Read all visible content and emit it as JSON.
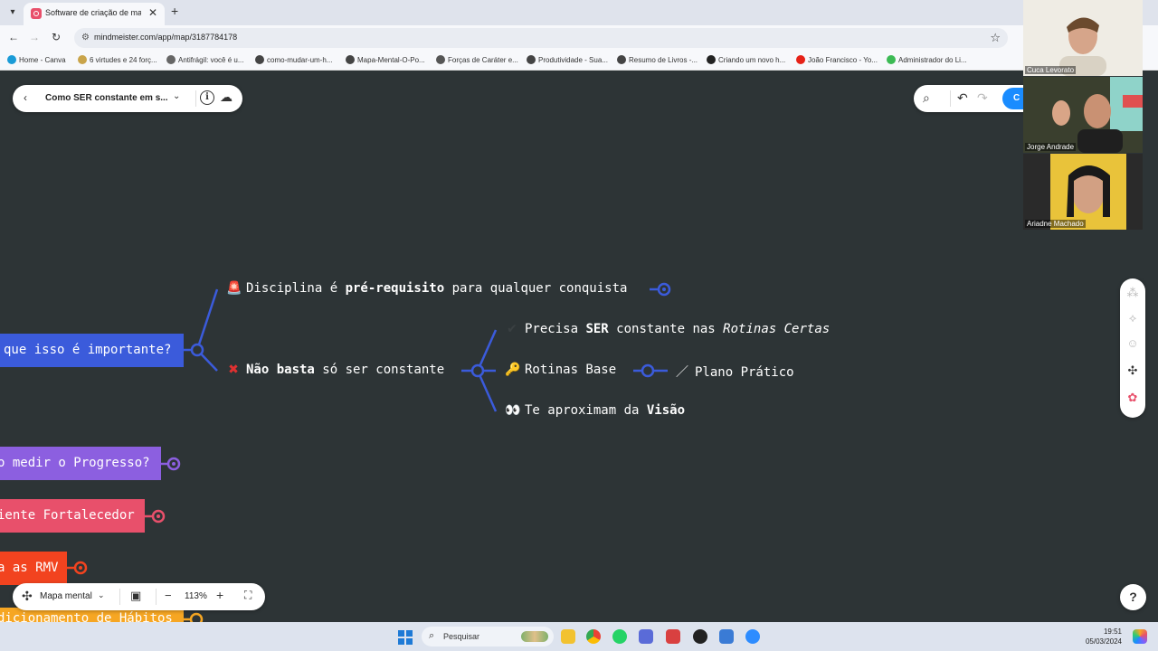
{
  "browser": {
    "tab_title": "Software de criação de mapas",
    "tab_close": "✕",
    "new_tab": "+",
    "url": "mindmeister.com/app/map/3187784178",
    "bookmarks": [
      {
        "label": "Home - Canva",
        "color": "#1a9bd7"
      },
      {
        "label": "6 virtudes e 24 forç...",
        "color": "#c9a44a"
      },
      {
        "label": "Antifrágil: você é u...",
        "color": "#666666"
      },
      {
        "label": "como-mudar-um-h...",
        "color": "#444444"
      },
      {
        "label": "Mapa-Mental-O-Po...",
        "color": "#444444"
      },
      {
        "label": "Forças de Caráter e...",
        "color": "#555555"
      },
      {
        "label": "Produtividade - Sua...",
        "color": "#444444"
      },
      {
        "label": "Resumo de Livros -...",
        "color": "#444444"
      },
      {
        "label": "Criando um novo h...",
        "color": "#222222"
      },
      {
        "label": "João Francisco - Yo...",
        "color": "#e62117"
      },
      {
        "label": "Administrador do Li...",
        "color": "#3cba54"
      }
    ]
  },
  "toolbar": {
    "map_title": "Como SER constante em s...",
    "share_label": "C"
  },
  "participants": [
    {
      "name": "Cuca Levorato"
    },
    {
      "name": "Jorge Andrade"
    },
    {
      "name": "Ariadne Machado"
    }
  ],
  "mindmap": {
    "branch_why": "que isso é importante?",
    "branch_progress": "o medir o Progresso?",
    "branch_env": "iente Fortalecedor",
    "branch_rmv": "a as RMV",
    "branch_habits": "dicionamento de Hábitos",
    "disciplina": {
      "emoji": "🚨",
      "pre": "Disciplina é ",
      "bold": "pré-requisito",
      "post": " para qualquer conquista"
    },
    "nao_basta": {
      "emoji": "✖",
      "bold": "Não basta",
      "post": " só ser constante"
    },
    "precisa": {
      "emoji": "✔",
      "pre": "Precisa ",
      "bold": "SER",
      "mid": " constante nas ",
      "italic": "Rotinas Certas"
    },
    "rotinas": {
      "emoji": "🔑",
      "label": "Rotinas Base"
    },
    "plano": {
      "emoji": "／",
      "label": "Plano Prático"
    },
    "visao": {
      "emoji": "👀",
      "pre": "Te aproximam da ",
      "bold": "Visão"
    }
  },
  "bottom_bar": {
    "layout_label": "Mapa mental",
    "zoom": "113%"
  },
  "taskbar": {
    "search_label": "Pesquisar",
    "time": "19:51",
    "date": "05/03/2024"
  },
  "colors": {
    "canvas": "#2d3436",
    "connector": "#3b5bdb",
    "branch_why": "#3b5bdb",
    "branch_progress": "#8c5fe0",
    "branch_env": "#e8506b",
    "branch_rmv": "#f2431f",
    "branch_habits": "#f6a623"
  }
}
